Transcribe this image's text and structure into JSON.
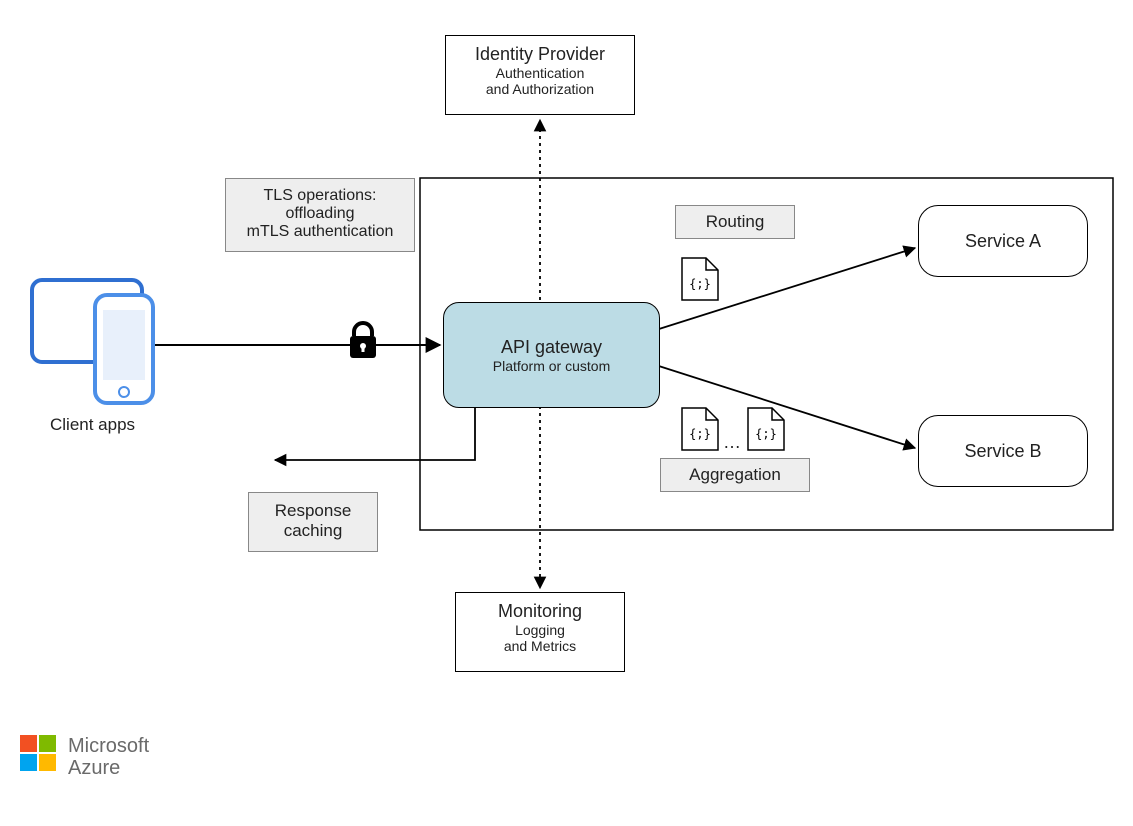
{
  "identityProvider": {
    "title": "Identity Provider",
    "sub1": "Authentication",
    "sub2": "and Authorization"
  },
  "tlsBox": {
    "line1": "TLS operations:",
    "line2": "offloading",
    "line3": "mTLS authentication"
  },
  "routing": {
    "label": "Routing"
  },
  "aggregation": {
    "label": "Aggregation",
    "dots": "…"
  },
  "serviceA": {
    "label": "Service A"
  },
  "serviceB": {
    "label": "Service B"
  },
  "gateway": {
    "title": "API gateway",
    "sub": "Platform or custom"
  },
  "responseCaching": {
    "line1": "Response",
    "line2": "caching"
  },
  "monitoring": {
    "title": "Monitoring",
    "sub1": "Logging",
    "sub2": "and Metrics"
  },
  "clientApps": {
    "label": "Client apps"
  },
  "brand": {
    "name": "Microsoft",
    "product": "Azure"
  },
  "icons": {
    "lock": "lock-icon",
    "doc": "document-code-icon",
    "tablet": "tablet-icon",
    "phone": "phone-icon"
  },
  "colors": {
    "gatewayFill": "#bcdce5",
    "grayFill": "#eeeeee",
    "azureRed": "#f25022",
    "azureGreen": "#7fba00",
    "azureBlue": "#00a4ef",
    "azureYellow": "#ffb900",
    "deviceBlue1": "#2f6fd1",
    "deviceBlue2": "#4c8fe8"
  }
}
